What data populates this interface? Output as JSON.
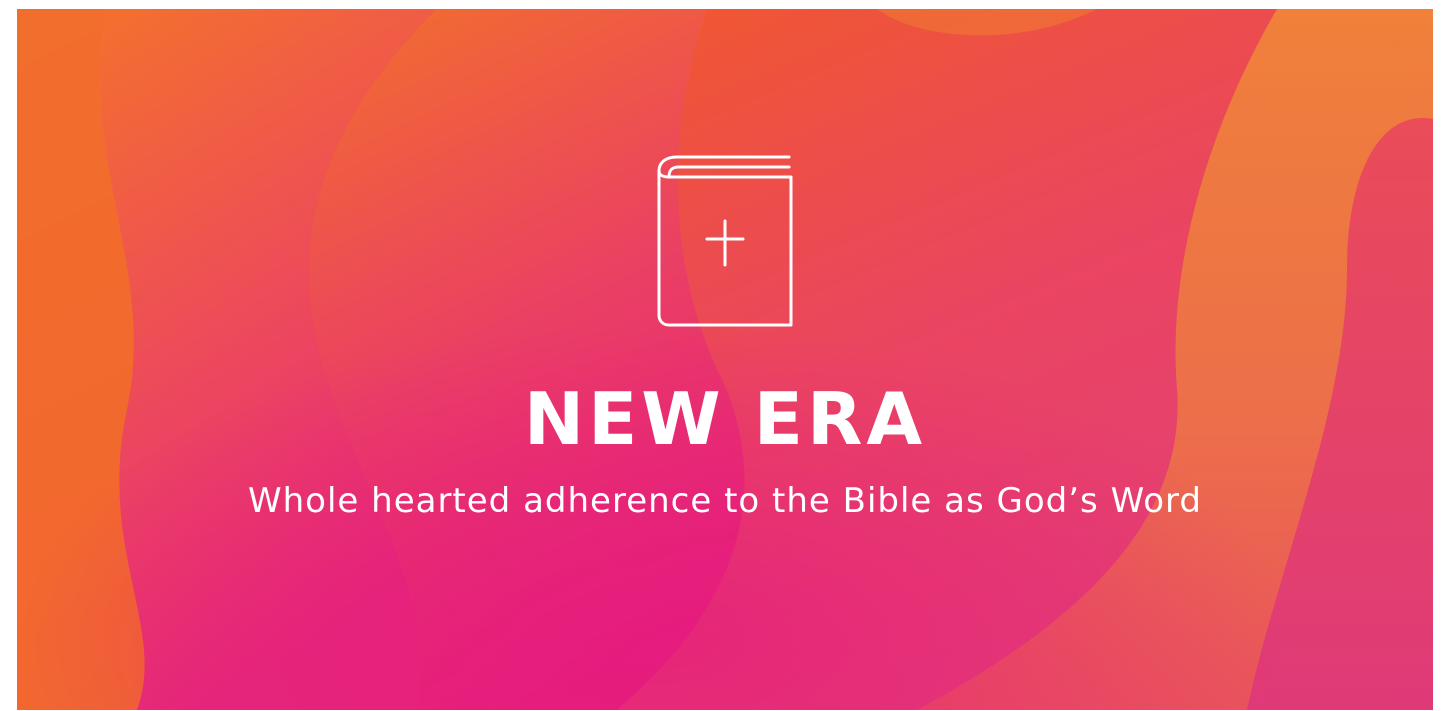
{
  "banner": {
    "title": "NEW ERA",
    "subtitle": "Whole hearted adherence to the Bible as God’s Word",
    "icon": "bible-book-icon",
    "colors": {
      "orange": "#f5852a",
      "deep_orange": "#f05a2e",
      "magenta": "#e71f78",
      "pink": "#e9466a",
      "text": "#ffffff"
    }
  }
}
